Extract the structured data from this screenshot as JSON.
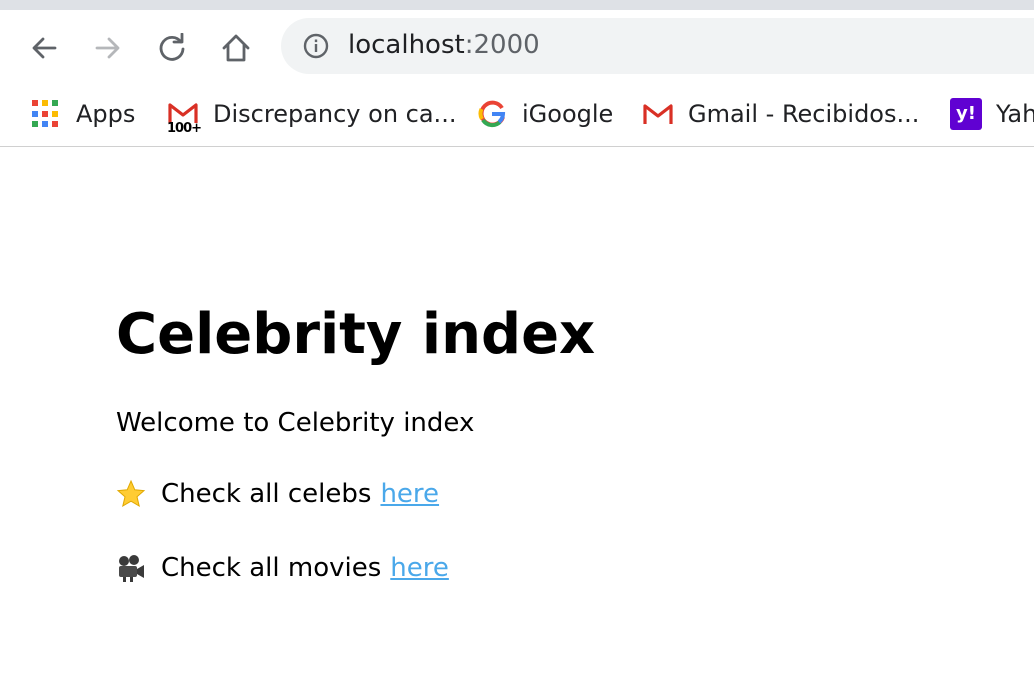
{
  "browser": {
    "url_host": "localhost",
    "url_port": ":2000",
    "nav_icons": [
      "back-icon",
      "forward-icon",
      "reload-icon",
      "home-icon",
      "info-icon"
    ]
  },
  "bookmarks": [
    {
      "label": "Apps",
      "icon": "apps-grid-icon"
    },
    {
      "label": "Discrepancy on ca...",
      "icon": "gmail-icon",
      "badge": "100+"
    },
    {
      "label": "iGoogle",
      "icon": "google-icon"
    },
    {
      "label": "Gmail - Recibidos...",
      "icon": "gmail-icon"
    },
    {
      "label": "Yah",
      "icon": "yahoo-icon"
    }
  ],
  "page": {
    "title": "Celebrity index",
    "welcome": "Welcome to Celebrity index",
    "celebs_text": "Check all celebs",
    "celebs_link": "here",
    "movies_text": "Check all movies",
    "movies_link": "here"
  },
  "colors": {
    "link": "#4aa8ea",
    "omnibox_bg": "#f1f3f4",
    "yahoo_purple": "#6001d2",
    "gmail_red": "#d93025"
  }
}
